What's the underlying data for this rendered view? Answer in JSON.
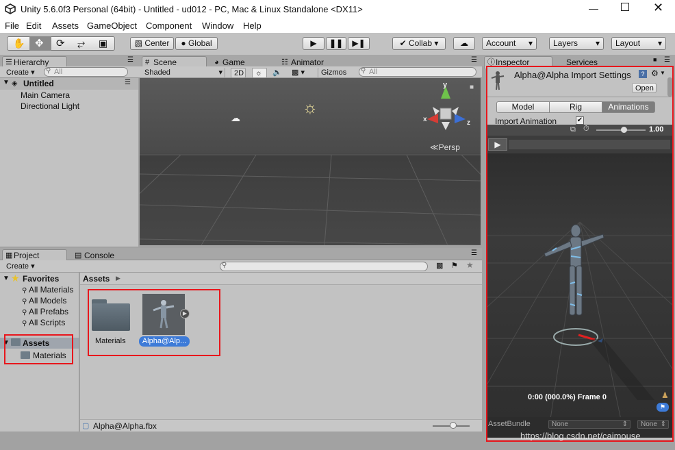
{
  "window": {
    "title": "Unity 5.6.0f3 Personal (64bit) - Untitled - ud012 - PC, Mac & Linux Standalone <DX11>"
  },
  "menu": [
    "File",
    "Edit",
    "Assets",
    "GameObject",
    "Component",
    "Window",
    "Help"
  ],
  "toolbar": {
    "pivot": "Center",
    "space": "Global",
    "collab": "Collab",
    "account": "Account",
    "layers": "Layers",
    "layout": "Layout"
  },
  "hierarchy": {
    "tab": "Hierarchy",
    "create": "Create",
    "search_placeholder": "All",
    "scene": "Untitled",
    "items": [
      "Main Camera",
      "Directional Light"
    ]
  },
  "scene": {
    "tabs": [
      "Scene",
      "Game",
      "Animator"
    ],
    "shading": "Shaded",
    "mode2d": "2D",
    "gizmos": "Gizmos",
    "search_placeholder": "All",
    "persp": "Persp",
    "axis_y": "y",
    "axis_x": "x",
    "axis_z": "z"
  },
  "inspector": {
    "tabs": [
      "Inspector",
      "Services"
    ],
    "title": "Alpha@Alpha Import Settings",
    "open": "Open",
    "import_tabs": [
      "Model",
      "Rig",
      "Animations"
    ],
    "import_animation": "Import Animation",
    "speed": "1.00",
    "preview_status": "0:00 (000.0%) Frame 0",
    "assetbundle_label": "AssetBundle",
    "assetbundle_value": "None",
    "assetbundle_variant": "None"
  },
  "project": {
    "tabs": [
      "Project",
      "Console"
    ],
    "create": "Create",
    "favorites": "Favorites",
    "favorite_items": [
      "All Materials",
      "All Models",
      "All Prefabs",
      "All Scripts"
    ],
    "assets_root": "Assets",
    "assets_children": [
      "Materials"
    ],
    "breadcrumb": "Assets",
    "items": [
      "Materials",
      "Alpha@Alp..."
    ],
    "footer_file": "Alpha@Alpha.fbx"
  },
  "watermark": "https://blog.csdn.net/caimouse",
  "colors": {
    "highlight_red": "#e8161c",
    "selection_blue": "#3d7bd8"
  }
}
